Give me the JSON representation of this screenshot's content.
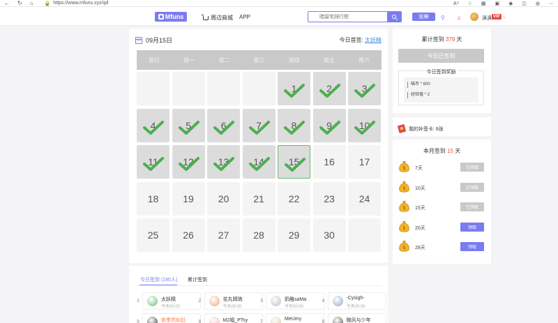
{
  "browser": {
    "url_prefix": "https://",
    "url": "www.mfuns.xyz/qd"
  },
  "header": {
    "logo_text": "Mfuns",
    "nav": [
      {
        "label": "周边商城",
        "icon": "cart-icon"
      },
      {
        "label": "APP"
      }
    ],
    "search_placeholder": "暗留宅排行榜",
    "upload_label": "投稿",
    "user_name": "涣涣",
    "vip_label": "VIP"
  },
  "calendar": {
    "date_label": "09月15日",
    "icon_day": "31",
    "first_signin_label": "今日首签:",
    "first_signin_user": "太妖精",
    "weekdays": [
      "周日",
      "周一",
      "周二",
      "周三",
      "周四",
      "周五",
      "周六"
    ],
    "days": [
      {
        "n": "",
        "s": 0
      },
      {
        "n": "",
        "s": 0
      },
      {
        "n": "",
        "s": 0
      },
      {
        "n": "",
        "s": 0
      },
      {
        "n": "1",
        "s": 1
      },
      {
        "n": "2",
        "s": 1
      },
      {
        "n": "3",
        "s": 1
      },
      {
        "n": "4",
        "s": 1
      },
      {
        "n": "5",
        "s": 1
      },
      {
        "n": "6",
        "s": 1
      },
      {
        "n": "7",
        "s": 1
      },
      {
        "n": "8",
        "s": 1
      },
      {
        "n": "9",
        "s": 1
      },
      {
        "n": "10",
        "s": 1
      },
      {
        "n": "11",
        "s": 1
      },
      {
        "n": "12",
        "s": 1
      },
      {
        "n": "13",
        "s": 1
      },
      {
        "n": "14",
        "s": 1
      },
      {
        "n": "15",
        "s": 2
      },
      {
        "n": "16",
        "s": 0
      },
      {
        "n": "17",
        "s": 0
      },
      {
        "n": "18",
        "s": 0
      },
      {
        "n": "19",
        "s": 0
      },
      {
        "n": "20",
        "s": 0
      },
      {
        "n": "21",
        "s": 0
      },
      {
        "n": "22",
        "s": 0
      },
      {
        "n": "23",
        "s": 0
      },
      {
        "n": "24",
        "s": 0
      },
      {
        "n": "25",
        "s": 0
      },
      {
        "n": "26",
        "s": 0
      },
      {
        "n": "27",
        "s": 0
      },
      {
        "n": "28",
        "s": 0
      },
      {
        "n": "29",
        "s": 0
      },
      {
        "n": "30",
        "s": 0
      },
      {
        "n": "",
        "s": 0
      }
    ],
    "check_color": "#4caf50"
  },
  "tabs": {
    "today_label": "今日签到 (195人)",
    "total_label": "累计签到"
  },
  "signin_users": [
    {
      "rank": "1",
      "name": "太妖精",
      "time": "今天00:00",
      "orange": false,
      "avatar": "#6bbf72"
    },
    {
      "rank": "2",
      "name": "花丸晴琉",
      "time": "今天00:00",
      "orange": false,
      "avatar": "#f1a37a"
    },
    {
      "rank": "3",
      "name": "奶酪saMa",
      "time": "今天00:00",
      "orange": false,
      "avatar": "#c4b8c8"
    },
    {
      "rank": "4",
      "name": "-Cysigh-",
      "time": "今天00:00",
      "orange": false,
      "avatar": "#8fa6c8"
    },
    {
      "rank": "5",
      "name": "依季然如旧",
      "time": "",
      "orange": true,
      "avatar": "#3a3a3a"
    },
    {
      "rank": "6",
      "name": "M2福_PTsy",
      "time": "",
      "orange": false,
      "avatar": "#f2b8c0"
    },
    {
      "rank": "7",
      "name": "MeUmy",
      "time": "",
      "orange": false,
      "avatar": "#d6c9a6"
    },
    {
      "rank": "8",
      "name": "微风与少年",
      "time": "",
      "orange": false,
      "avatar": "#555555"
    }
  ],
  "sidebar": {
    "total_prefix": "累计签到",
    "total_days": "379",
    "total_suffix": "天",
    "signed_button": "今日已签到",
    "reward_title": "今日签到奖励",
    "rewards": [
      "喵币 * 600",
      "经验值 * 2"
    ],
    "makeup_card": "我的补签卡: 6张",
    "month_prefix": "本月签到",
    "month_days": "15",
    "month_suffix": "天",
    "milestones": [
      {
        "label": "7天",
        "button": "已领取",
        "claimed": true
      },
      {
        "label": "10天",
        "button": "已领取",
        "claimed": true
      },
      {
        "label": "15天",
        "button": "已领取",
        "claimed": true
      },
      {
        "label": "20天",
        "button": "领取",
        "claimed": false
      },
      {
        "label": "28天",
        "button": "领取",
        "claimed": false
      }
    ]
  }
}
